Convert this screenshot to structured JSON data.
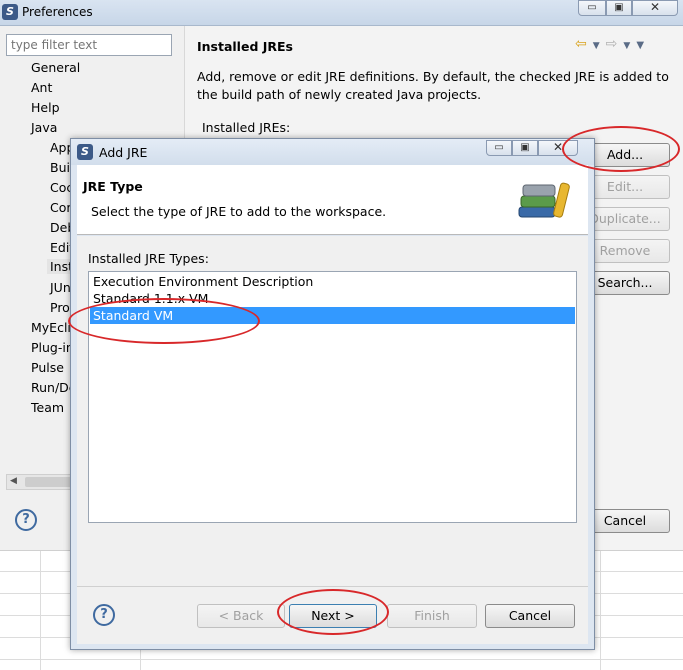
{
  "preferences": {
    "title": "Preferences",
    "filter_placeholder": "type filter text",
    "tree": [
      {
        "label": "General"
      },
      {
        "label": "Ant"
      },
      {
        "label": "Help"
      },
      {
        "label": "Java"
      },
      {
        "label": "App"
      },
      {
        "label": "Buil"
      },
      {
        "label": "Coc"
      },
      {
        "label": "Cor"
      },
      {
        "label": "Deb"
      },
      {
        "label": "Edit"
      },
      {
        "label": "Inst"
      },
      {
        "label": "JUn"
      },
      {
        "label": "Pro"
      },
      {
        "label": "MyEcli"
      },
      {
        "label": "Plug-in"
      },
      {
        "label": "Pulse"
      },
      {
        "label": "Run/De"
      },
      {
        "label": "Team"
      }
    ],
    "page_title": "Installed JREs",
    "description": "Add, remove or edit JRE definitions. By default, the checked JRE is added to the build path of newly created Java projects.",
    "installed_jres_label": "Installed JREs:",
    "buttons": {
      "add": "Add...",
      "edit": "Edit...",
      "duplicate": "Duplicate...",
      "remove": "Remove",
      "search": "Search...",
      "cancel": "Cancel"
    }
  },
  "dialog": {
    "title": "Add JRE",
    "header_title": "JRE Type",
    "header_subtitle": "Select the type of JRE to add to the workspace.",
    "types_label": "Installed JRE Types:",
    "types": [
      {
        "label": "Execution Environment Description",
        "selected": false
      },
      {
        "label": "Standard 1.1.x VM",
        "selected": false
      },
      {
        "label": "Standard VM",
        "selected": true
      }
    ],
    "buttons": {
      "back": "< Back",
      "next": "Next >",
      "finish": "Finish",
      "cancel": "Cancel"
    }
  },
  "colors": {
    "selection": "#3399ff",
    "annotation": "#d8282a"
  }
}
